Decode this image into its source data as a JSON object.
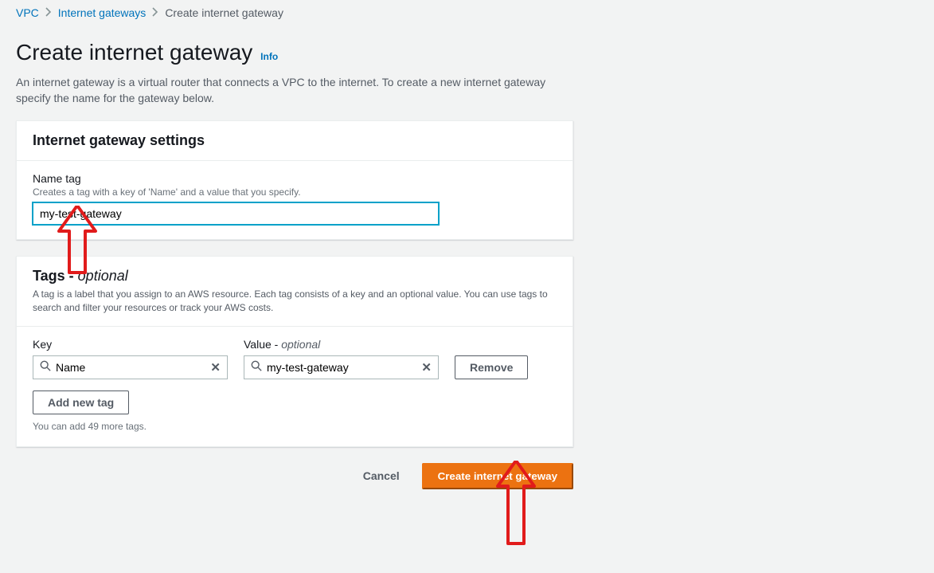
{
  "breadcrumbs": {
    "root": "VPC",
    "parent": "Internet gateways",
    "current": "Create internet gateway"
  },
  "header": {
    "title": "Create internet gateway",
    "info": "Info",
    "desc": "An internet gateway is a virtual router that connects a VPC to the internet. To create a new internet gateway specify the name for the gateway below."
  },
  "settings": {
    "panel_title": "Internet gateway settings",
    "name_label": "Name tag",
    "name_hint": "Creates a tag with a key of 'Name' and a value that you specify.",
    "name_value": "my-test-gateway"
  },
  "tags": {
    "title_prefix": "Tags - ",
    "title_optional": "optional",
    "desc": "A tag is a label that you assign to an AWS resource. Each tag consists of a key and an optional value. You can use tags to search and filter your resources or track your AWS costs.",
    "key_label": "Key",
    "value_label_prefix": "Value - ",
    "value_label_optional": "optional",
    "row": {
      "key": "Name",
      "value": "my-test-gateway"
    },
    "remove_label": "Remove",
    "add_label": "Add new tag",
    "limit_text": "You can add 49 more tags."
  },
  "actions": {
    "cancel": "Cancel",
    "submit": "Create internet gateway"
  }
}
